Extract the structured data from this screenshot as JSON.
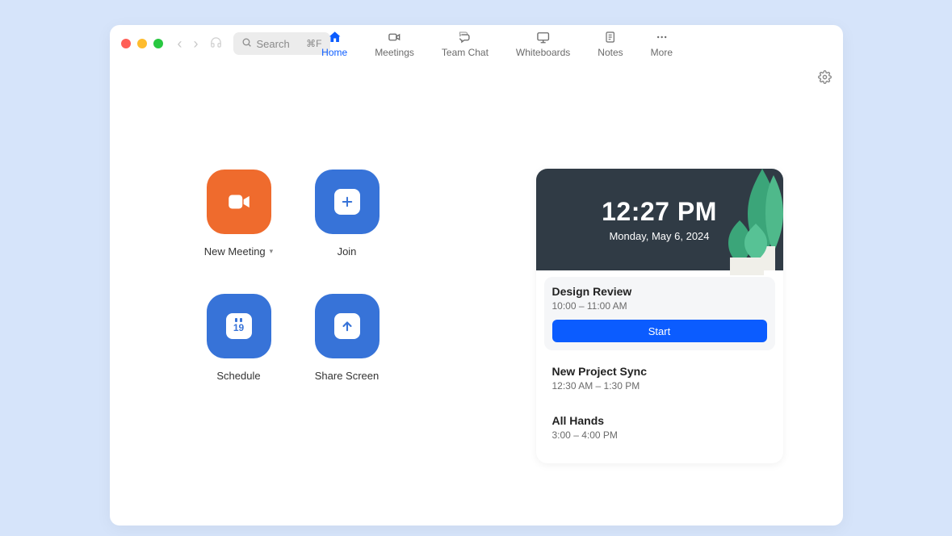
{
  "search": {
    "placeholder": "Search",
    "shortcut": "⌘F"
  },
  "tabs": {
    "home": "Home",
    "meetings": "Meetings",
    "teamchat": "Team Chat",
    "whiteboards": "Whiteboards",
    "notes": "Notes",
    "more": "More"
  },
  "actions": {
    "new_meeting": "New Meeting",
    "join": "Join",
    "schedule": "Schedule",
    "schedule_day": "19",
    "share_screen": "Share Screen"
  },
  "clock": {
    "time": "12:27 PM",
    "date": "Monday, May 6, 2024"
  },
  "events": [
    {
      "title": "Design Review",
      "time": "10:00 – 11:00 AM",
      "start": "Start"
    },
    {
      "title": "New Project Sync",
      "time": "12:30 AM – 1:30 PM"
    },
    {
      "title": "All Hands",
      "time": "3:00 – 4:00 PM"
    }
  ]
}
